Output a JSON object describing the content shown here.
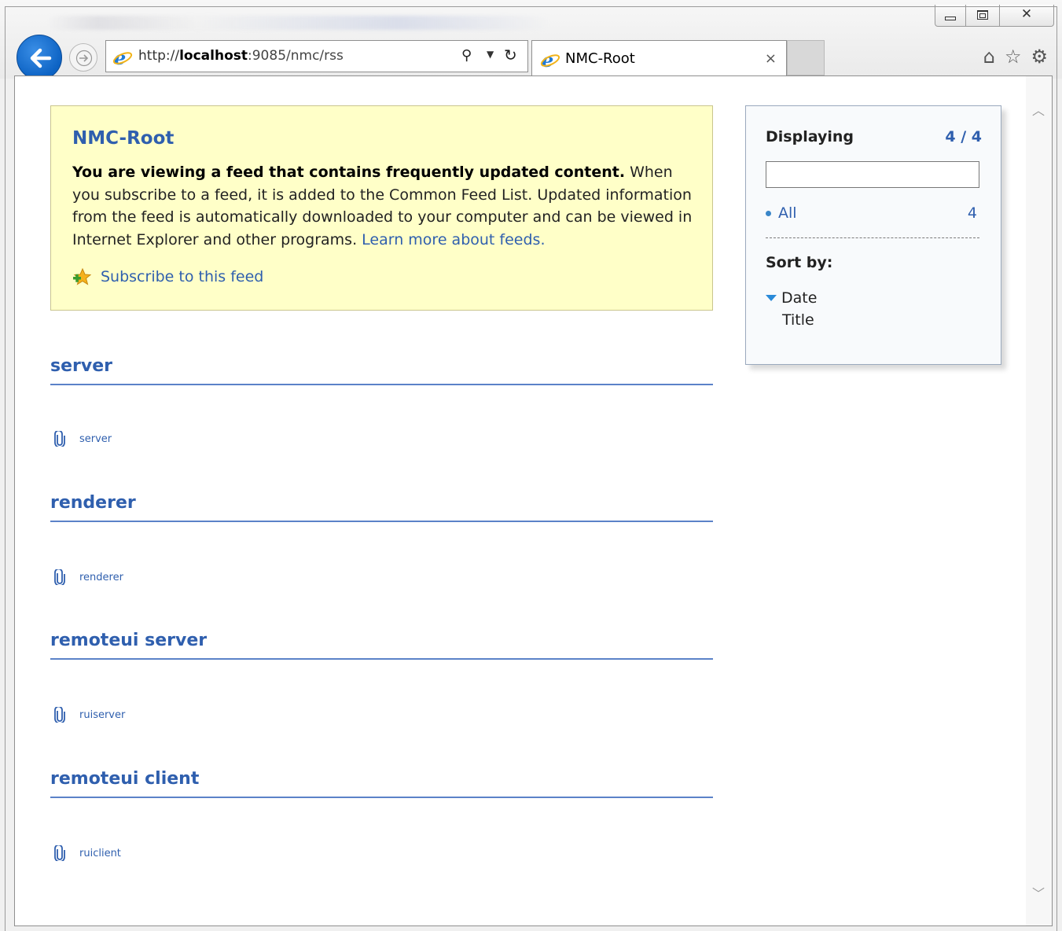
{
  "browser": {
    "address": {
      "prefix": "http://",
      "host": "localhost",
      "rest": ":9085/nmc/rss"
    },
    "tab": {
      "title": "NMC-Root",
      "close": "×"
    },
    "icons": [
      "back-icon",
      "forward-icon",
      "ie-icon",
      "search-icon",
      "dropdown-icon",
      "refresh-icon",
      "home-icon",
      "favorites-star-icon",
      "settings-gear-icon"
    ],
    "window_controls": {
      "close": "✕"
    }
  },
  "feed": {
    "title": "NMC-Root",
    "intro_bold": "You are viewing a feed that contains frequently updated content.",
    "intro_text": " When you subscribe to a feed, it is added to the Common Feed List. Updated information from the feed is automatically downloaded to your computer and can be viewed in Internet Explorer and other programs. ",
    "learn_more": "Learn more about feeds.",
    "subscribe": "Subscribe to this feed"
  },
  "entries": [
    {
      "title": "server",
      "enclosure": "server"
    },
    {
      "title": "renderer",
      "enclosure": "renderer"
    },
    {
      "title": "remoteui server",
      "enclosure": "ruiserver"
    },
    {
      "title": "remoteui client",
      "enclosure": "ruiclient"
    }
  ],
  "sidebar": {
    "displaying_label": "Displaying",
    "count": "4 / 4",
    "filter_value": "",
    "all_label": "All",
    "all_count": "4",
    "sort_label": "Sort by:",
    "sort_options": [
      "Date",
      "Title"
    ]
  },
  "colors": {
    "accent": "#2f5fae",
    "header_bg": "#ffffc8",
    "rule": "#5b82c8"
  }
}
